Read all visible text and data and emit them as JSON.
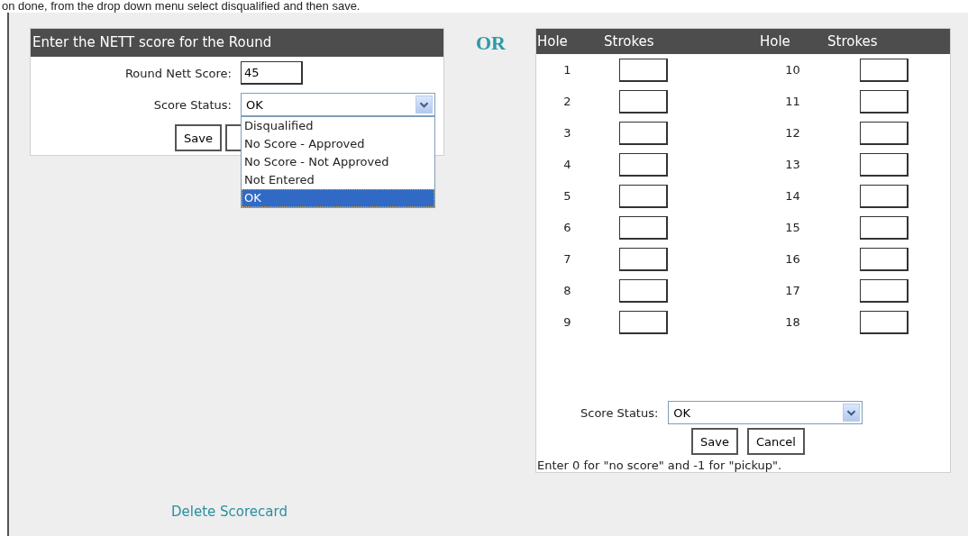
{
  "instruction": "on done, from the drop down menu select disqualified and then save.",
  "nett_panel": {
    "title": "Enter the NETT score for the Round",
    "score_label": "Round Nett Score:",
    "score_value": "45",
    "status_label": "Score Status:",
    "status_value": "OK",
    "save": "Save",
    "dropdown": {
      "options": [
        {
          "label": "Disqualified",
          "selected": false
        },
        {
          "label": "No Score - Approved",
          "selected": false
        },
        {
          "label": "No Score - Not Approved",
          "selected": false
        },
        {
          "label": "Not Entered",
          "selected": false
        },
        {
          "label": "OK",
          "selected": true
        }
      ]
    }
  },
  "or": "OR",
  "strokes_panel": {
    "columns": [
      "Hole",
      "Strokes",
      "Hole",
      "Strokes"
    ],
    "holes": [
      "1",
      "2",
      "3",
      "4",
      "5",
      "6",
      "7",
      "8",
      "9",
      "10",
      "11",
      "12",
      "13",
      "14",
      "15",
      "16",
      "17",
      "18"
    ],
    "status_label": "Score Status:",
    "status_value": "OK",
    "buttons": [
      "Save",
      "Cancel"
    ],
    "note": "Enter 0 for \"no score\" and -1 for \"pickup\"."
  },
  "delete_link": "Delete Scorecard"
}
